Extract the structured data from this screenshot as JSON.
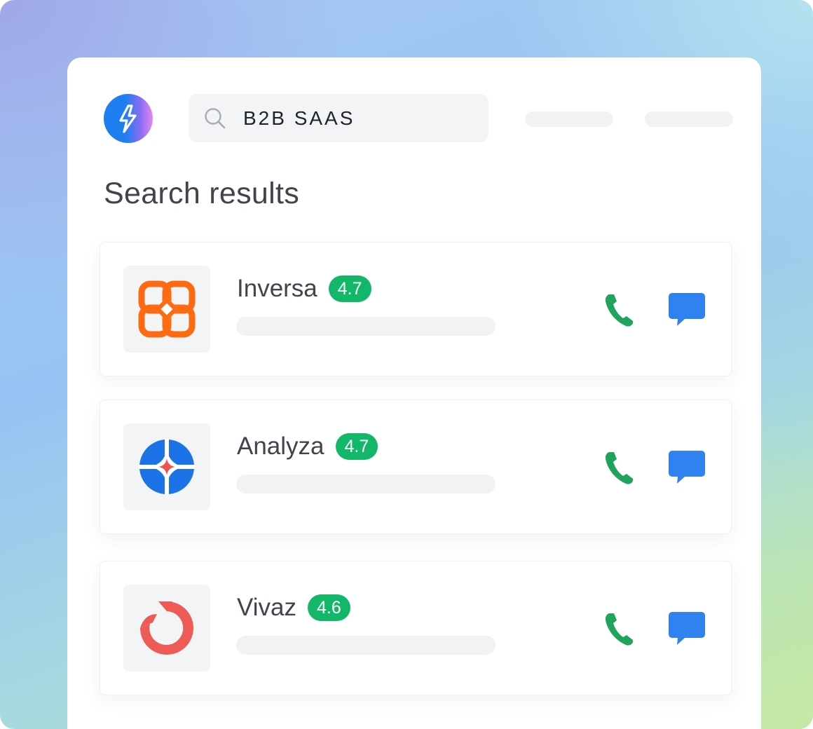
{
  "app": {
    "logo_icon": "lightning-bolt-icon",
    "brand_gradient": [
      "#1f7ff0",
      "#e388f2"
    ]
  },
  "search": {
    "value": "B2B SAAS",
    "icon": "search-icon"
  },
  "page": {
    "title": "Search results"
  },
  "colors": {
    "rating_badge": "#12b76a",
    "call_icon": "#20a35a",
    "chat_icon": "#2f82f0"
  },
  "results": [
    {
      "name": "Inversa",
      "rating": "4.7",
      "logo_icon": "inversa-logo-icon",
      "logo_color": "#fd6a12"
    },
    {
      "name": "Analyza",
      "rating": "4.7",
      "logo_icon": "analyza-logo-icon",
      "logo_color": "#1c73e8"
    },
    {
      "name": "Vivaz",
      "rating": "4.6",
      "logo_icon": "vivaz-logo-icon",
      "logo_color": "#ee5a55"
    }
  ]
}
